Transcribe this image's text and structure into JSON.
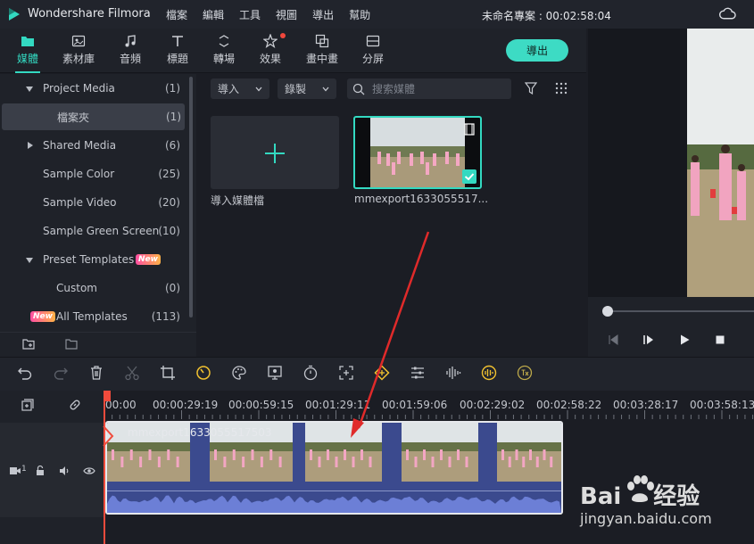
{
  "app": {
    "name": "Wondershare Filmora",
    "project": "未命名專案 : 00:02:58:04"
  },
  "menu": [
    "檔案",
    "編輯",
    "工具",
    "視圖",
    "導出",
    "幫助"
  ],
  "categories": [
    {
      "label": "媒體",
      "icon": "folder-icon",
      "active": true
    },
    {
      "label": "素材庫",
      "icon": "library-icon"
    },
    {
      "label": "音頻",
      "icon": "music-note-icon"
    },
    {
      "label": "標題",
      "icon": "text-icon"
    },
    {
      "label": "轉場",
      "icon": "transition-icon"
    },
    {
      "label": "效果",
      "icon": "effects-icon",
      "dot": true
    },
    {
      "label": "畫中畫",
      "icon": "pip-icon"
    },
    {
      "label": "分屏",
      "icon": "split-screen-icon"
    }
  ],
  "export_label": "導出",
  "tree": [
    {
      "label": "Project Media",
      "count": "(1)",
      "expanded": true
    },
    {
      "label": "檔案夾",
      "count": "(1)",
      "selected": true
    },
    {
      "label": "Shared Media",
      "count": "(6)"
    },
    {
      "label": "Sample Color",
      "count": "(25)"
    },
    {
      "label": "Sample Video",
      "count": "(20)"
    },
    {
      "label": "Sample Green Screen",
      "count": "(10)"
    },
    {
      "label": "Preset Templates",
      "count": "",
      "badge": "New",
      "expanded": true
    },
    {
      "label": "Custom",
      "count": "(0)"
    },
    {
      "label": "All Templates",
      "count": "(113)",
      "badge": "New"
    }
  ],
  "media_toolbar": {
    "import_label": "導入",
    "record_label": "錄製",
    "search_placeholder": "搜索媒體"
  },
  "media_items": {
    "import_tile_label": "導入媒體檔",
    "clip_label": "mmexport1633055517..."
  },
  "timeline": {
    "ticks": [
      "00:00",
      "00:00:29:19",
      "00:00:59:15",
      "00:01:29:11",
      "00:01:59:06",
      "00:02:29:02",
      "00:02:58:22",
      "00:03:28:17",
      "00:03:58:13"
    ],
    "clip_name": "mmexport1633055517503",
    "track_number": "1"
  },
  "watermark": {
    "logo": "Bai du 经验",
    "url": "jingyan.baidu.com"
  },
  "colors": {
    "accent": "#33d9c1",
    "playhead": "#f04b3c",
    "clip": "#3b4a8e"
  }
}
